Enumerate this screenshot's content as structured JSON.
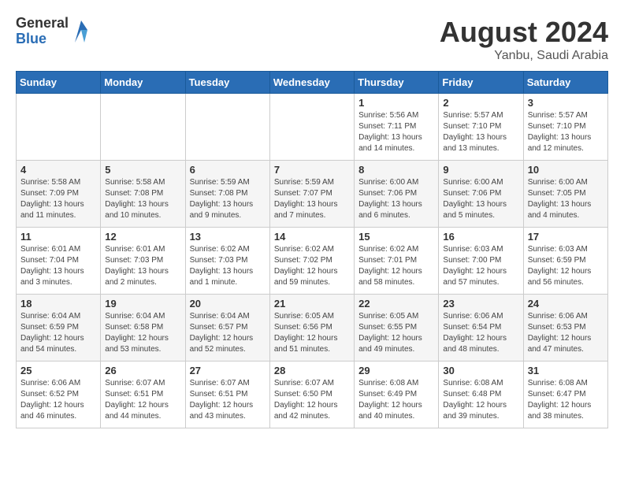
{
  "logo": {
    "general": "General",
    "blue": "Blue"
  },
  "title": {
    "month_year": "August 2024",
    "location": "Yanbu, Saudi Arabia"
  },
  "headers": [
    "Sunday",
    "Monday",
    "Tuesday",
    "Wednesday",
    "Thursday",
    "Friday",
    "Saturday"
  ],
  "weeks": [
    [
      {
        "day": "",
        "info": ""
      },
      {
        "day": "",
        "info": ""
      },
      {
        "day": "",
        "info": ""
      },
      {
        "day": "",
        "info": ""
      },
      {
        "day": "1",
        "info": "Sunrise: 5:56 AM\nSunset: 7:11 PM\nDaylight: 13 hours\nand 14 minutes."
      },
      {
        "day": "2",
        "info": "Sunrise: 5:57 AM\nSunset: 7:10 PM\nDaylight: 13 hours\nand 13 minutes."
      },
      {
        "day": "3",
        "info": "Sunrise: 5:57 AM\nSunset: 7:10 PM\nDaylight: 13 hours\nand 12 minutes."
      }
    ],
    [
      {
        "day": "4",
        "info": "Sunrise: 5:58 AM\nSunset: 7:09 PM\nDaylight: 13 hours\nand 11 minutes."
      },
      {
        "day": "5",
        "info": "Sunrise: 5:58 AM\nSunset: 7:08 PM\nDaylight: 13 hours\nand 10 minutes."
      },
      {
        "day": "6",
        "info": "Sunrise: 5:59 AM\nSunset: 7:08 PM\nDaylight: 13 hours\nand 9 minutes."
      },
      {
        "day": "7",
        "info": "Sunrise: 5:59 AM\nSunset: 7:07 PM\nDaylight: 13 hours\nand 7 minutes."
      },
      {
        "day": "8",
        "info": "Sunrise: 6:00 AM\nSunset: 7:06 PM\nDaylight: 13 hours\nand 6 minutes."
      },
      {
        "day": "9",
        "info": "Sunrise: 6:00 AM\nSunset: 7:06 PM\nDaylight: 13 hours\nand 5 minutes."
      },
      {
        "day": "10",
        "info": "Sunrise: 6:00 AM\nSunset: 7:05 PM\nDaylight: 13 hours\nand 4 minutes."
      }
    ],
    [
      {
        "day": "11",
        "info": "Sunrise: 6:01 AM\nSunset: 7:04 PM\nDaylight: 13 hours\nand 3 minutes."
      },
      {
        "day": "12",
        "info": "Sunrise: 6:01 AM\nSunset: 7:03 PM\nDaylight: 13 hours\nand 2 minutes."
      },
      {
        "day": "13",
        "info": "Sunrise: 6:02 AM\nSunset: 7:03 PM\nDaylight: 13 hours\nand 1 minute."
      },
      {
        "day": "14",
        "info": "Sunrise: 6:02 AM\nSunset: 7:02 PM\nDaylight: 12 hours\nand 59 minutes."
      },
      {
        "day": "15",
        "info": "Sunrise: 6:02 AM\nSunset: 7:01 PM\nDaylight: 12 hours\nand 58 minutes."
      },
      {
        "day": "16",
        "info": "Sunrise: 6:03 AM\nSunset: 7:00 PM\nDaylight: 12 hours\nand 57 minutes."
      },
      {
        "day": "17",
        "info": "Sunrise: 6:03 AM\nSunset: 6:59 PM\nDaylight: 12 hours\nand 56 minutes."
      }
    ],
    [
      {
        "day": "18",
        "info": "Sunrise: 6:04 AM\nSunset: 6:59 PM\nDaylight: 12 hours\nand 54 minutes."
      },
      {
        "day": "19",
        "info": "Sunrise: 6:04 AM\nSunset: 6:58 PM\nDaylight: 12 hours\nand 53 minutes."
      },
      {
        "day": "20",
        "info": "Sunrise: 6:04 AM\nSunset: 6:57 PM\nDaylight: 12 hours\nand 52 minutes."
      },
      {
        "day": "21",
        "info": "Sunrise: 6:05 AM\nSunset: 6:56 PM\nDaylight: 12 hours\nand 51 minutes."
      },
      {
        "day": "22",
        "info": "Sunrise: 6:05 AM\nSunset: 6:55 PM\nDaylight: 12 hours\nand 49 minutes."
      },
      {
        "day": "23",
        "info": "Sunrise: 6:06 AM\nSunset: 6:54 PM\nDaylight: 12 hours\nand 48 minutes."
      },
      {
        "day": "24",
        "info": "Sunrise: 6:06 AM\nSunset: 6:53 PM\nDaylight: 12 hours\nand 47 minutes."
      }
    ],
    [
      {
        "day": "25",
        "info": "Sunrise: 6:06 AM\nSunset: 6:52 PM\nDaylight: 12 hours\nand 46 minutes."
      },
      {
        "day": "26",
        "info": "Sunrise: 6:07 AM\nSunset: 6:51 PM\nDaylight: 12 hours\nand 44 minutes."
      },
      {
        "day": "27",
        "info": "Sunrise: 6:07 AM\nSunset: 6:51 PM\nDaylight: 12 hours\nand 43 minutes."
      },
      {
        "day": "28",
        "info": "Sunrise: 6:07 AM\nSunset: 6:50 PM\nDaylight: 12 hours\nand 42 minutes."
      },
      {
        "day": "29",
        "info": "Sunrise: 6:08 AM\nSunset: 6:49 PM\nDaylight: 12 hours\nand 40 minutes."
      },
      {
        "day": "30",
        "info": "Sunrise: 6:08 AM\nSunset: 6:48 PM\nDaylight: 12 hours\nand 39 minutes."
      },
      {
        "day": "31",
        "info": "Sunrise: 6:08 AM\nSunset: 6:47 PM\nDaylight: 12 hours\nand 38 minutes."
      }
    ]
  ]
}
